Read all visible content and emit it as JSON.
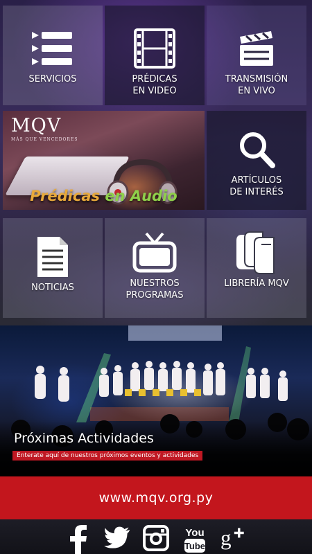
{
  "menu": [
    {
      "id": "servicios",
      "label": "SERVICIOS",
      "icon": "list-icon"
    },
    {
      "id": "predicas-video",
      "label": "PRÉDICAS\nEN VIDEO",
      "icon": "film-strip-icon"
    },
    {
      "id": "transmision",
      "label": "TRANSMISIÓN\nEN VIVO",
      "icon": "clapperboard-icon"
    },
    {
      "id": "articulos",
      "label": "ARTÍCULOS\nDE INTERÉS",
      "icon": "magnifier-icon"
    },
    {
      "id": "noticias",
      "label": "NOTICIAS",
      "icon": "document-icon"
    },
    {
      "id": "programas",
      "label": "NUESTROS\nPROGRAMAS",
      "icon": "tv-icon"
    },
    {
      "id": "libreria",
      "label": "LIBRERÍA MQV",
      "icon": "books-icon"
    }
  ],
  "audio_banner": {
    "brand": "MQV",
    "brand_tagline": "MÁS QUE VENCEDORES",
    "title_part1": "Prédicas",
    "title_part2": "en Audio"
  },
  "events": {
    "title": "Próximas Actividades",
    "subtitle": "Enterate aquí de nuestros próximos eventos y actividades"
  },
  "website": "www.mqv.org.py",
  "social": [
    {
      "name": "facebook",
      "icon": "facebook-icon"
    },
    {
      "name": "twitter",
      "icon": "twitter-icon"
    },
    {
      "name": "instagram",
      "icon": "instagram-icon"
    },
    {
      "name": "youtube",
      "icon": "youtube-icon"
    },
    {
      "name": "google-plus",
      "icon": "google-plus-icon"
    }
  ]
}
